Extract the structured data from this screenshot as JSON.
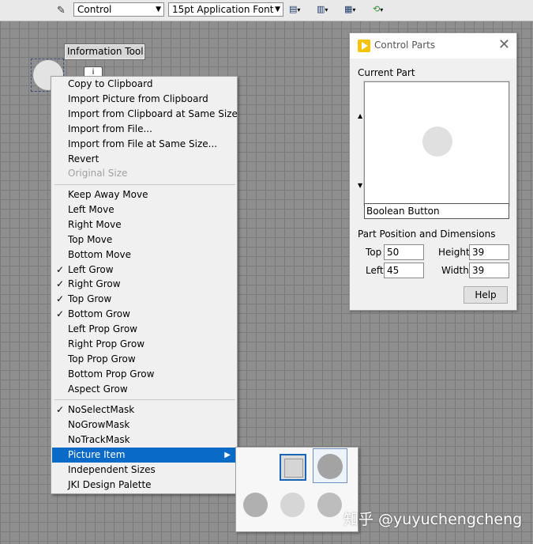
{
  "toolbar": {
    "pen_icon": "pen-icon",
    "combo_control": "Control",
    "combo_font": "15pt Application Font",
    "align_icon": "align-icon",
    "distribute_icon": "distribute-icon",
    "resize_icon": "resize-icon",
    "reorder_icon": "reorder-icon"
  },
  "canvas": {
    "info_tip": "Information Tool",
    "cursor_icon": "information-tool-cursor-icon"
  },
  "context_menu": {
    "group1": [
      {
        "label": "Copy to Clipboard",
        "enabled": true
      },
      {
        "label": "Import Picture from Clipboard",
        "enabled": true
      },
      {
        "label": "Import from Clipboard at Same Size",
        "enabled": true
      },
      {
        "label": "Import from File...",
        "enabled": true
      },
      {
        "label": "Import from File at Same Size...",
        "enabled": true
      },
      {
        "label": "Revert",
        "enabled": true
      },
      {
        "label": "Original Size",
        "enabled": false
      }
    ],
    "group2": [
      {
        "label": "Keep Away Move",
        "checked": false
      },
      {
        "label": "Left Move",
        "checked": false
      },
      {
        "label": "Right Move",
        "checked": false
      },
      {
        "label": "Top Move",
        "checked": false
      },
      {
        "label": "Bottom Move",
        "checked": false
      },
      {
        "label": "Left Grow",
        "checked": true
      },
      {
        "label": "Right Grow",
        "checked": true
      },
      {
        "label": "Top Grow",
        "checked": true
      },
      {
        "label": "Bottom Grow",
        "checked": true
      },
      {
        "label": "Left Prop Grow",
        "checked": false
      },
      {
        "label": "Right Prop Grow",
        "checked": false
      },
      {
        "label": "Top Prop Grow",
        "checked": false
      },
      {
        "label": "Bottom Prop Grow",
        "checked": false
      },
      {
        "label": "Aspect Grow",
        "checked": false
      }
    ],
    "group3": [
      {
        "label": "NoSelectMask",
        "checked": true
      },
      {
        "label": "NoGrowMask",
        "checked": false
      },
      {
        "label": "NoTrackMask",
        "checked": false
      },
      {
        "label": "Picture Item",
        "checked": false,
        "highlighted": true,
        "submenu": true
      },
      {
        "label": "Independent Sizes",
        "checked": false
      },
      {
        "label": "JKI Design Palette",
        "checked": false
      }
    ],
    "check_mark": "✓",
    "submenu_arrow": "▶"
  },
  "submenu": {
    "items": [
      "picture-item-1",
      "picture-item-2",
      "picture-item-3",
      "picture-item-4",
      "picture-item-5"
    ]
  },
  "control_parts": {
    "title": "Control Parts",
    "current_part_label": "Current Part",
    "part_name": "Boolean Button",
    "section_label": "Part Position and Dimensions",
    "top_label": "Top",
    "top_value": "50",
    "left_label": "Left",
    "left_value": "45",
    "height_label": "Height",
    "height_value": "39",
    "width_label": "Width",
    "width_value": "39",
    "help_label": "Help"
  },
  "watermark": "知乎 @yuyuchengcheng",
  "colors": {
    "highlight": "#0a6ac7",
    "canvas_bg": "#8f8f8f",
    "logo": "#f7c300"
  }
}
